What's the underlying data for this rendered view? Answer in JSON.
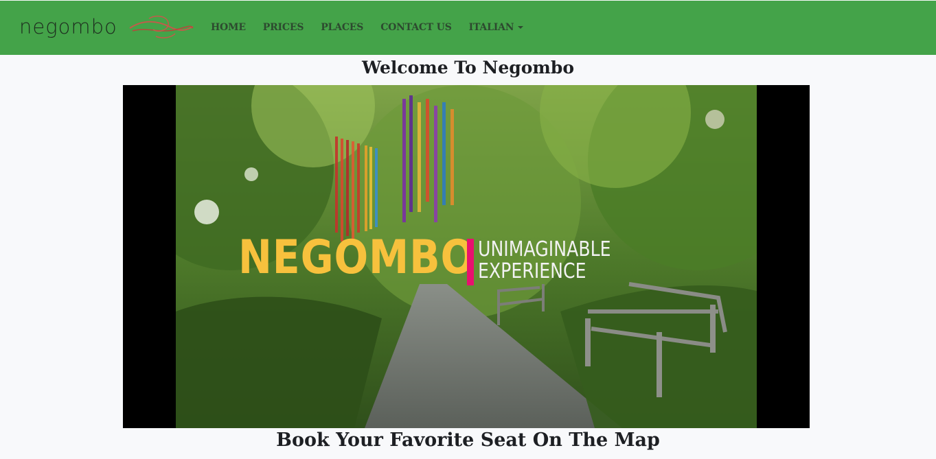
{
  "header": {
    "logo_text": "negombo",
    "nav": [
      {
        "label": "HOME"
      },
      {
        "label": "PRICES"
      },
      {
        "label": "PLACES"
      },
      {
        "label": "CONTACT US"
      },
      {
        "label": "ITALIAN",
        "dropdown": true
      }
    ],
    "bg_color": "#44a349"
  },
  "main": {
    "title": "Welcome To Negombo",
    "video": {
      "brand": "NEGOMBO",
      "tagline_line1": "UNIMAGINABLE",
      "tagline_line2": "EXPERIENCE",
      "brand_color": "#f7c13d",
      "bar_color": "#e8116f"
    },
    "subtitle": "Book Your Favorite Seat On The Map"
  }
}
